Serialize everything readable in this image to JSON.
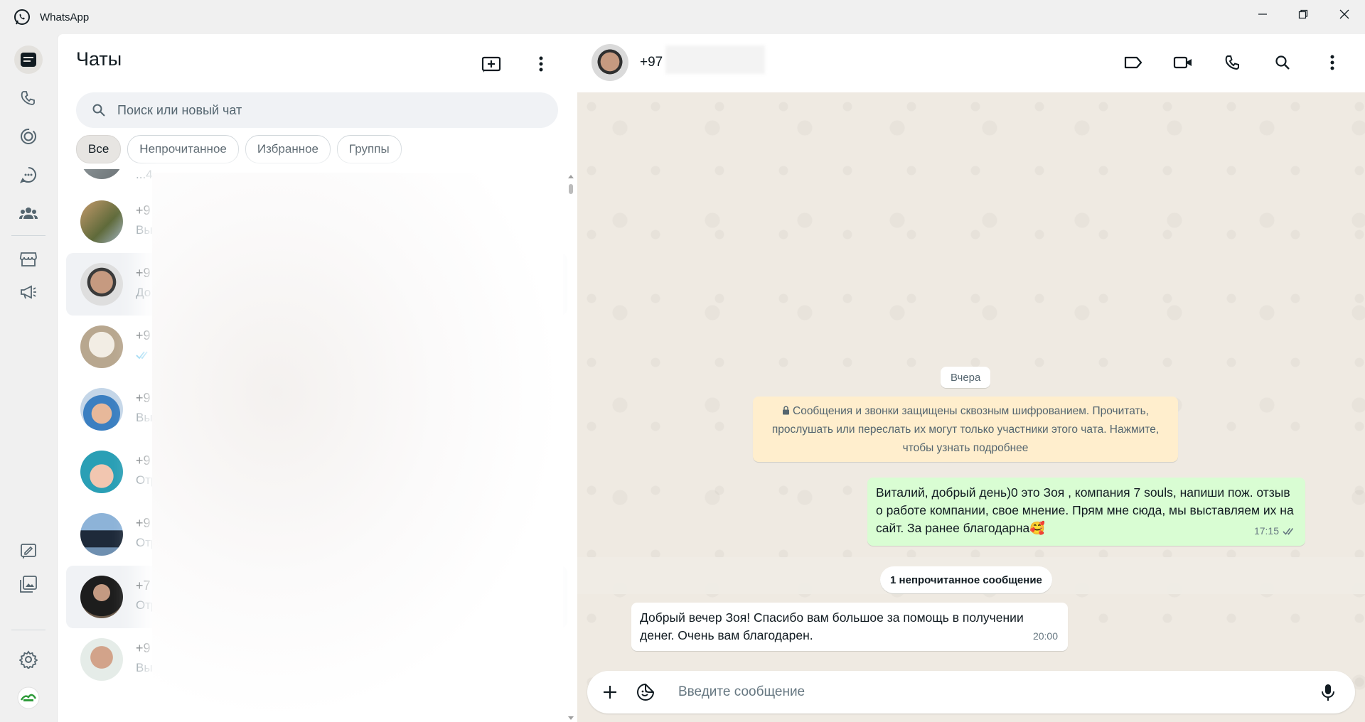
{
  "window": {
    "title": "WhatsApp",
    "controls": [
      "minimize-icon",
      "restore-icon",
      "close-icon"
    ]
  },
  "rail": {
    "top_items": [
      "chats-icon",
      "calls-icon",
      "status-icon",
      "channels-icon",
      "communities-icon"
    ],
    "middle_items": [
      "business-tools-icon",
      "advertise-icon"
    ],
    "bottom_items": [
      "starred-messages-icon",
      "media-gallery-icon",
      "settings-icon",
      "profile-avatar"
    ]
  },
  "chats_panel": {
    "title": "Чаты",
    "search_placeholder": "Поиск или новый чат",
    "filters": [
      "Все",
      "Непрочитанное",
      "Избранное",
      "Группы"
    ],
    "active_filter": "Все",
    "top_partial_preview": "...4",
    "chats": [
      {
        "name": "+9",
        "preview": "Вы",
        "selected": false,
        "read_receipt": false
      },
      {
        "name": "+9",
        "preview": "До",
        "selected": true,
        "read_receipt": false
      },
      {
        "name": "+9",
        "preview": "",
        "selected": false,
        "read_receipt": true
      },
      {
        "name": "+9",
        "preview": "Вы",
        "selected": false,
        "read_receipt": false
      },
      {
        "name": "+9",
        "preview": "Отр",
        "selected": false,
        "read_receipt": false
      },
      {
        "name": "+9",
        "preview": "Отр",
        "selected": false,
        "read_receipt": false
      },
      {
        "name": "+7",
        "preview": "Отр",
        "selected": true,
        "read_receipt": false
      },
      {
        "name": "+9",
        "preview": "Вы",
        "selected": false,
        "read_receipt": false
      }
    ]
  },
  "conversation": {
    "contact_name": "+97",
    "header_actions": [
      "label-icon",
      "video-call-icon",
      "voice-call-icon",
      "search-icon",
      "menu-icon"
    ],
    "date_divider": "Вчера",
    "encryption_notice": "Сообщения и звонки защищены сквозным шифрованием. Прочитать, прослушать или переслать их могут только участники этого чата. Нажмите, чтобы узнать подробнее",
    "messages": [
      {
        "direction": "out",
        "text": "Виталий, добрый день)0 это Зоя , компания 7 souls, напиши пож. отзыв о работе компании, свое мнение. Прям мне сюда, мы выставляем их на сайт. За ранее благодарна🥰",
        "time": "17:15",
        "status": "read"
      },
      {
        "direction": "in",
        "text": "Добрый вечер Зоя! Спасибо вам большое за помощь в получении денег. Очень вам благодарен.",
        "time": "20:00"
      }
    ],
    "unread_divider": "1 непрочитанное сообщение",
    "composer_placeholder": "Введите сообщение"
  },
  "colors": {
    "outgoing_bubble": "#d9fdd3",
    "incoming_bubble": "#ffffff",
    "chat_background": "#efeae2",
    "system_notice": "#ffeecd",
    "read_check": "#53bdeb"
  }
}
